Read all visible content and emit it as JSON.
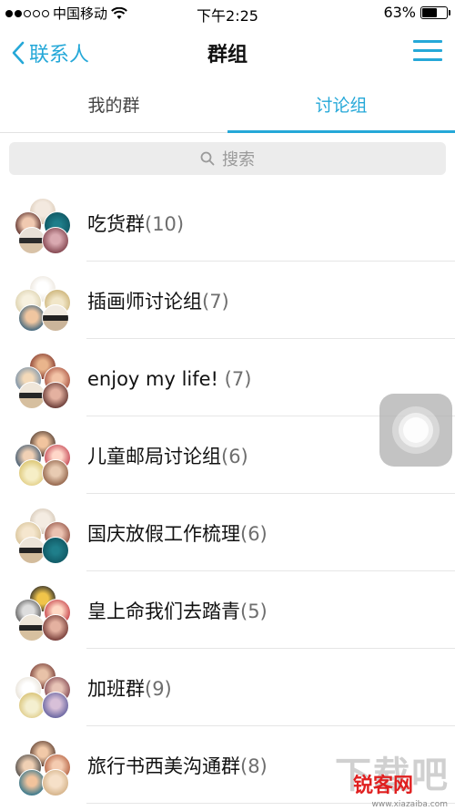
{
  "status_bar": {
    "carrier": "中国移动",
    "time": "下午2:25",
    "battery": "63%",
    "battery_level": 0.63,
    "signal_bars_filled": 2,
    "signal_bars_total": 5
  },
  "nav": {
    "back_label": "联系人",
    "title": "群组"
  },
  "tabs": [
    {
      "label": "我的群",
      "active": false
    },
    {
      "label": "讨论组",
      "active": true
    }
  ],
  "search": {
    "placeholder": "搜索"
  },
  "groups": [
    {
      "name": "吃货群",
      "count": "(10)"
    },
    {
      "name": "插画师讨论组",
      "count": "(7)"
    },
    {
      "name": "enjoy my life!",
      "count": "(7)"
    },
    {
      "name": "儿童邮局讨论组",
      "count": "(6)"
    },
    {
      "name": "国庆放假工作梳理",
      "count": "(6)"
    },
    {
      "name": "皇上命我们去踏青",
      "count": "(5)"
    },
    {
      "name": "加班群",
      "count": "(9)"
    },
    {
      "name": "旅行书西美沟通群",
      "count": "(8)"
    }
  ],
  "watermark": {
    "big": "下载吧",
    "brand": "锐客网",
    "url": "www.xiazaiba.com"
  },
  "colors": {
    "accent": "#25a8d8",
    "divider": "#e6e6e6"
  }
}
